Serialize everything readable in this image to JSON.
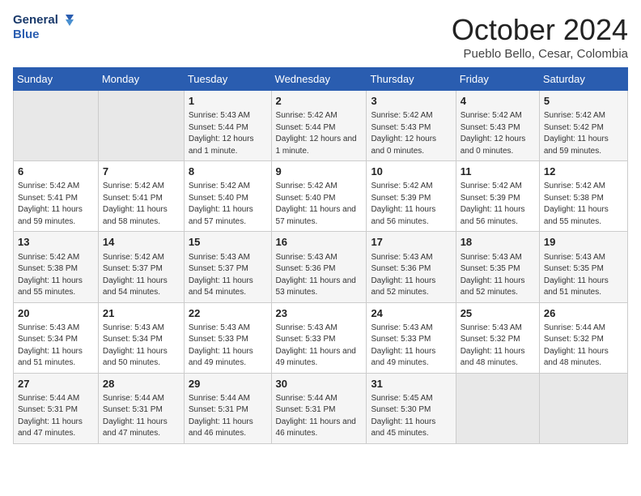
{
  "logo": {
    "line1": "General",
    "line2": "Blue"
  },
  "title": "October 2024",
  "location": "Pueblo Bello, Cesar, Colombia",
  "days_header": [
    "Sunday",
    "Monday",
    "Tuesday",
    "Wednesday",
    "Thursday",
    "Friday",
    "Saturday"
  ],
  "weeks": [
    [
      {
        "day": "",
        "empty": true
      },
      {
        "day": "",
        "empty": true
      },
      {
        "day": "1",
        "sunrise": "5:43 AM",
        "sunset": "5:44 PM",
        "daylight": "12 hours and 1 minute."
      },
      {
        "day": "2",
        "sunrise": "5:42 AM",
        "sunset": "5:44 PM",
        "daylight": "12 hours and 1 minute."
      },
      {
        "day": "3",
        "sunrise": "5:42 AM",
        "sunset": "5:43 PM",
        "daylight": "12 hours and 0 minutes."
      },
      {
        "day": "4",
        "sunrise": "5:42 AM",
        "sunset": "5:43 PM",
        "daylight": "12 hours and 0 minutes."
      },
      {
        "day": "5",
        "sunrise": "5:42 AM",
        "sunset": "5:42 PM",
        "daylight": "11 hours and 59 minutes."
      }
    ],
    [
      {
        "day": "6",
        "sunrise": "5:42 AM",
        "sunset": "5:41 PM",
        "daylight": "11 hours and 59 minutes."
      },
      {
        "day": "7",
        "sunrise": "5:42 AM",
        "sunset": "5:41 PM",
        "daylight": "11 hours and 58 minutes."
      },
      {
        "day": "8",
        "sunrise": "5:42 AM",
        "sunset": "5:40 PM",
        "daylight": "11 hours and 57 minutes."
      },
      {
        "day": "9",
        "sunrise": "5:42 AM",
        "sunset": "5:40 PM",
        "daylight": "11 hours and 57 minutes."
      },
      {
        "day": "10",
        "sunrise": "5:42 AM",
        "sunset": "5:39 PM",
        "daylight": "11 hours and 56 minutes."
      },
      {
        "day": "11",
        "sunrise": "5:42 AM",
        "sunset": "5:39 PM",
        "daylight": "11 hours and 56 minutes."
      },
      {
        "day": "12",
        "sunrise": "5:42 AM",
        "sunset": "5:38 PM",
        "daylight": "11 hours and 55 minutes."
      }
    ],
    [
      {
        "day": "13",
        "sunrise": "5:42 AM",
        "sunset": "5:38 PM",
        "daylight": "11 hours and 55 minutes."
      },
      {
        "day": "14",
        "sunrise": "5:42 AM",
        "sunset": "5:37 PM",
        "daylight": "11 hours and 54 minutes."
      },
      {
        "day": "15",
        "sunrise": "5:43 AM",
        "sunset": "5:37 PM",
        "daylight": "11 hours and 54 minutes."
      },
      {
        "day": "16",
        "sunrise": "5:43 AM",
        "sunset": "5:36 PM",
        "daylight": "11 hours and 53 minutes."
      },
      {
        "day": "17",
        "sunrise": "5:43 AM",
        "sunset": "5:36 PM",
        "daylight": "11 hours and 52 minutes."
      },
      {
        "day": "18",
        "sunrise": "5:43 AM",
        "sunset": "5:35 PM",
        "daylight": "11 hours and 52 minutes."
      },
      {
        "day": "19",
        "sunrise": "5:43 AM",
        "sunset": "5:35 PM",
        "daylight": "11 hours and 51 minutes."
      }
    ],
    [
      {
        "day": "20",
        "sunrise": "5:43 AM",
        "sunset": "5:34 PM",
        "daylight": "11 hours and 51 minutes."
      },
      {
        "day": "21",
        "sunrise": "5:43 AM",
        "sunset": "5:34 PM",
        "daylight": "11 hours and 50 minutes."
      },
      {
        "day": "22",
        "sunrise": "5:43 AM",
        "sunset": "5:33 PM",
        "daylight": "11 hours and 49 minutes."
      },
      {
        "day": "23",
        "sunrise": "5:43 AM",
        "sunset": "5:33 PM",
        "daylight": "11 hours and 49 minutes."
      },
      {
        "day": "24",
        "sunrise": "5:43 AM",
        "sunset": "5:33 PM",
        "daylight": "11 hours and 49 minutes."
      },
      {
        "day": "25",
        "sunrise": "5:43 AM",
        "sunset": "5:32 PM",
        "daylight": "11 hours and 48 minutes."
      },
      {
        "day": "26",
        "sunrise": "5:44 AM",
        "sunset": "5:32 PM",
        "daylight": "11 hours and 48 minutes."
      }
    ],
    [
      {
        "day": "27",
        "sunrise": "5:44 AM",
        "sunset": "5:31 PM",
        "daylight": "11 hours and 47 minutes."
      },
      {
        "day": "28",
        "sunrise": "5:44 AM",
        "sunset": "5:31 PM",
        "daylight": "11 hours and 47 minutes."
      },
      {
        "day": "29",
        "sunrise": "5:44 AM",
        "sunset": "5:31 PM",
        "daylight": "11 hours and 46 minutes."
      },
      {
        "day": "30",
        "sunrise": "5:44 AM",
        "sunset": "5:31 PM",
        "daylight": "11 hours and 46 minutes."
      },
      {
        "day": "31",
        "sunrise": "5:45 AM",
        "sunset": "5:30 PM",
        "daylight": "11 hours and 45 minutes."
      },
      {
        "day": "",
        "empty": true
      },
      {
        "day": "",
        "empty": true
      }
    ]
  ]
}
